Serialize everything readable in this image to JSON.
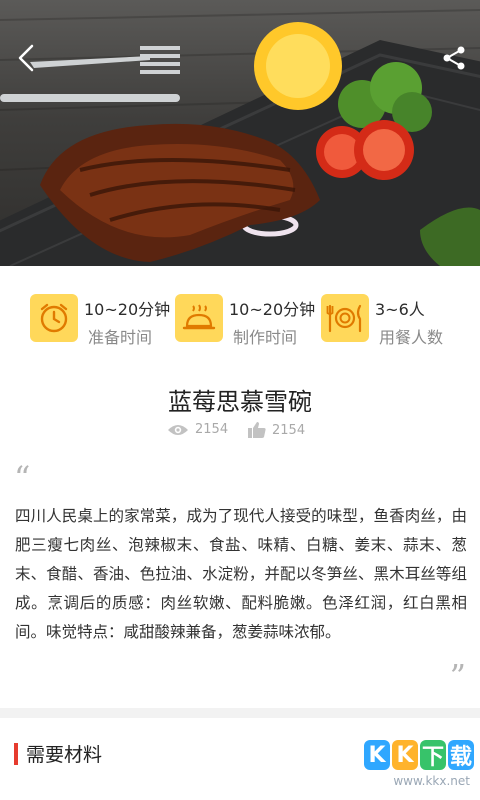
{
  "hero": {
    "back_icon": "chevron-left-icon",
    "share_icon": "share-icon",
    "image": "steak-dish-photo"
  },
  "info": [
    {
      "icon": "alarm-clock-icon",
      "value": "10~20分钟",
      "label": "准备时间"
    },
    {
      "icon": "cooking-pot-icon",
      "value": "10~20分钟",
      "label": "制作时间"
    },
    {
      "icon": "plate-utensils-icon",
      "value": "3~6人",
      "label": "用餐人数"
    }
  ],
  "recipe": {
    "title": "蓝莓思慕雪碗",
    "views": "2154",
    "likes": "2154",
    "description": "四川人民桌上的家常菜，成为了现代人接受的味型，鱼香肉丝，由肥三瘦七肉丝、泡辣椒末、食盐、味精、白糖、姜末、蒜末、葱末、食醋、香油、色拉油、水淀粉，并配以冬笋丝、黑木耳丝等组成。烹调后的质感：肉丝软嫩、配料脆嫩。色泽红润，红白黑相间。味觉特点：咸甜酸辣兼备，葱姜蒜味浓郁。"
  },
  "section": {
    "materials_title": "需要材料"
  },
  "watermark": {
    "logo_letters": [
      "K",
      "K",
      "下",
      "载"
    ],
    "url": "www.kkx.net"
  },
  "colors": {
    "accent_yellow": "#ffd85a",
    "section_bar_red": "#e63b2e"
  }
}
